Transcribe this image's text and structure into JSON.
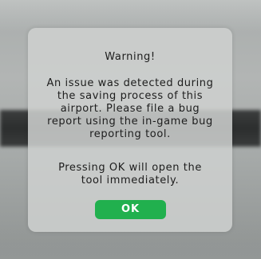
{
  "dialog": {
    "title": "Warning!",
    "message_lines": [
      "An issue was detected during",
      "the saving process of this",
      "airport. Please file a bug",
      "report using the in-game bug",
      "reporting tool."
    ],
    "secondary_lines": [
      "Pressing OK will open the",
      "tool immediately."
    ],
    "ok_label": "OK"
  },
  "colors": {
    "ok_button": "#21b04e",
    "dialog_background": "#ced0cf",
    "text": "#1d1d1d"
  }
}
